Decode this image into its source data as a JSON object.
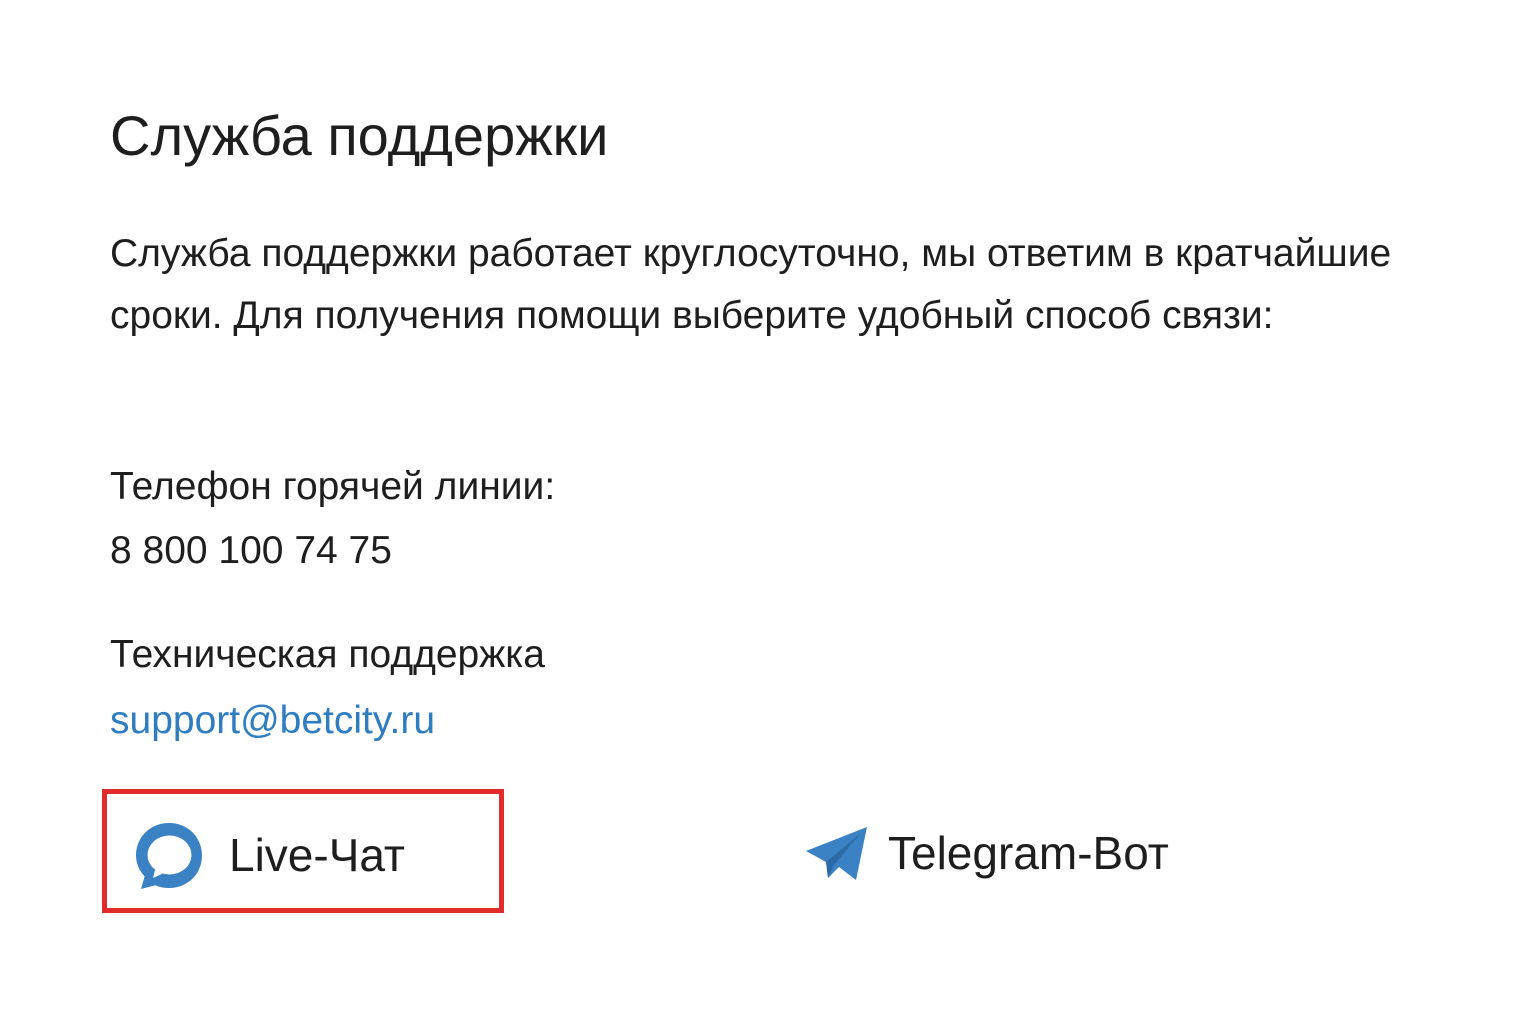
{
  "support": {
    "title": "Служба поддержки",
    "description": "Служба поддержки работает круглосуточно, мы ответим в кратчайшие сроки. Для получения помощи выберите удобный способ связи:",
    "hotline": {
      "label": "Телефон горячей линии:",
      "number": "8 800 100 74 75"
    },
    "tech": {
      "label": "Техническая поддержка",
      "email": "support@betcity.ru"
    },
    "channels": {
      "live_chat": {
        "label": "Live-Чат",
        "icon": "chat-bubble-icon"
      },
      "telegram": {
        "label": "Telegram-Bот",
        "icon": "telegram-paper-plane-icon"
      }
    }
  },
  "colors": {
    "text": "#1e1e1e",
    "link": "#2f7dc1",
    "icon_blue": "#3b82c4",
    "highlight_border": "#e22b2b",
    "background": "#ffffff"
  }
}
